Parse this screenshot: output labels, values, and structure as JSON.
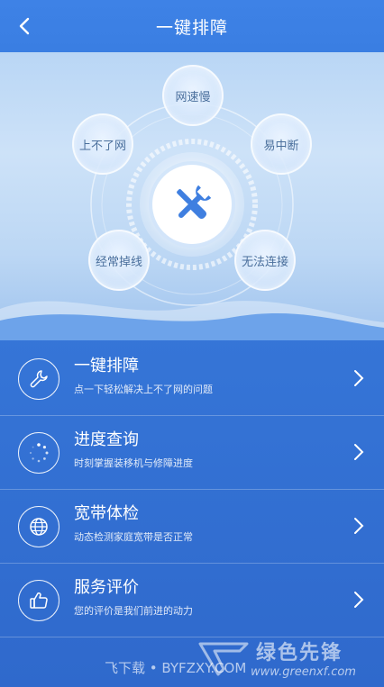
{
  "header": {
    "title": "一键排障",
    "back_icon": "chevron-left-icon"
  },
  "hero": {
    "center_icon": "tools-icon",
    "options": [
      {
        "label": "网速慢"
      },
      {
        "label": "上不了网"
      },
      {
        "label": "易中断"
      },
      {
        "label": "经常掉线"
      },
      {
        "label": "无法连接"
      }
    ]
  },
  "menu": {
    "items": [
      {
        "title": "一键排障",
        "subtitle": "点一下轻松解决上不了网的问题",
        "icon": "wrench-icon"
      },
      {
        "title": "进度查询",
        "subtitle": "时刻掌握装移机与修障进度",
        "icon": "progress-icon"
      },
      {
        "title": "宽带体检",
        "subtitle": "动态检测家庭宽带是否正常",
        "icon": "globe-icon"
      },
      {
        "title": "服务评价",
        "subtitle": "您的评价是我们前进的动力",
        "icon": "thumbs-up-icon"
      }
    ]
  },
  "watermark": {
    "left": "飞下载 • BYFZXY.COM",
    "brand": "绿色先锋",
    "url": "www.greenxf.com"
  },
  "colors": {
    "primary": "#3a7ee2",
    "hero_light": "#cde2f8",
    "bubble_text": "#4a6f9c",
    "center_icon": "#3f7fe0"
  }
}
